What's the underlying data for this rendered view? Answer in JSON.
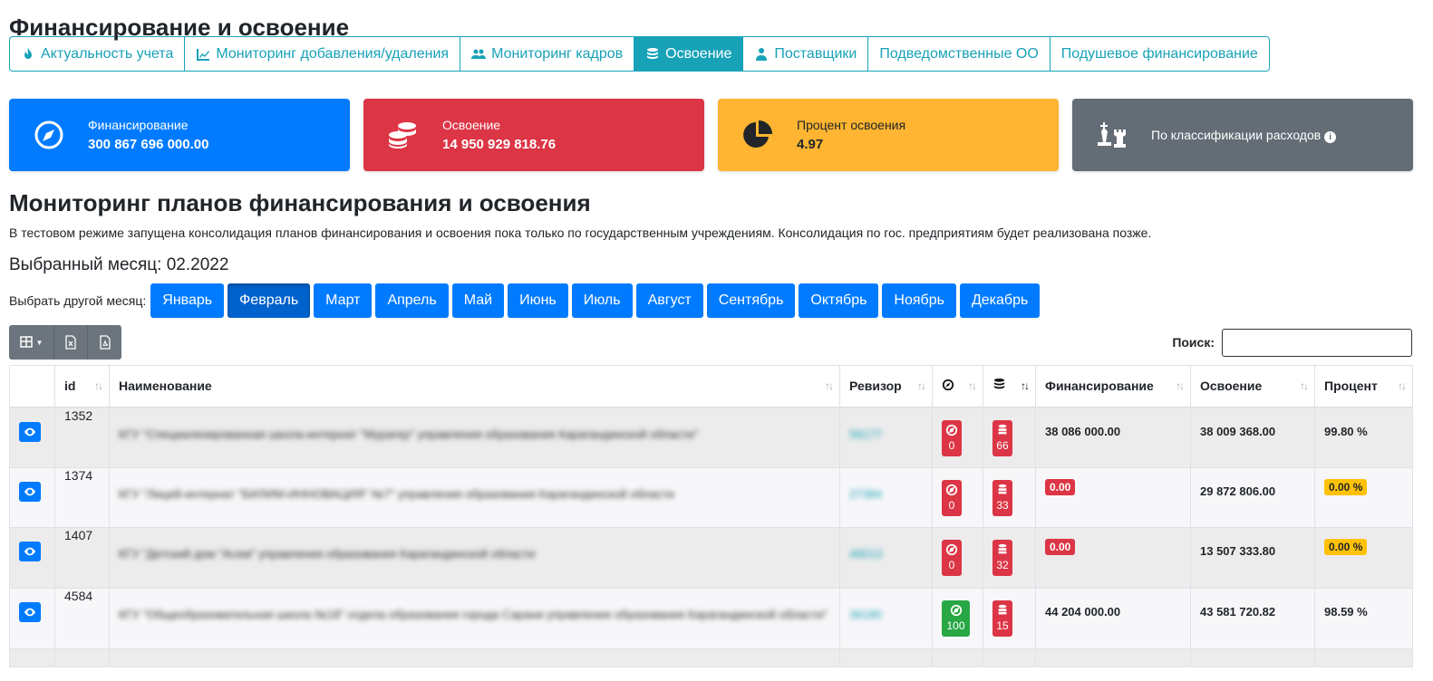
{
  "page_title": "Финансирование и освоение",
  "tabs": [
    {
      "label": "Актуальность учета",
      "icon": "fire-icon",
      "active": false
    },
    {
      "label": "Мониторинг добавления/удаления",
      "icon": "chart-line-icon",
      "active": false
    },
    {
      "label": "Мониторинг кадров",
      "icon": "users-icon",
      "active": false
    },
    {
      "label": "Освоение",
      "icon": "coins-icon",
      "active": true
    },
    {
      "label": "Поставщики",
      "icon": "user-tie-icon",
      "active": false
    },
    {
      "label": "Подведомственные ОО",
      "icon": "",
      "active": false
    },
    {
      "label": "Подушевое финансирование",
      "icon": "",
      "active": false
    }
  ],
  "cards": [
    {
      "title": "Финансирование",
      "value": "300 867 696 000.00",
      "icon": "compass-icon",
      "color": "#007bff"
    },
    {
      "title": "Освоение",
      "value": "14 950 929 818.76",
      "icon": "coins-icon",
      "color": "#dc3545"
    },
    {
      "title": "Процент освоения",
      "value": "4.97",
      "icon": "pie-chart-icon",
      "color": "#ffb531"
    },
    {
      "title": "По классификации расходов",
      "value": "",
      "icon": "chess-icon",
      "color": "#646d76"
    }
  ],
  "section_title": "Мониторинг планов финансирования и освоения",
  "note": "В тестовом режиме запущена консолидация планов финансирования и освоения пока только по государственным учреждениям. Консолидация по гос. предприятиям будет реализована позже.",
  "selected_month": "Выбранный месяц: 02.2022",
  "choose_month_label": "Выбрать другой месяц:",
  "months": [
    "Январь",
    "Февраль",
    "Март",
    "Апрель",
    "Май",
    "Июнь",
    "Июль",
    "Август",
    "Сентябрь",
    "Октябрь",
    "Ноябрь",
    "Декабрь"
  ],
  "active_month_index": 1,
  "search_label": "Поиск:",
  "search_value": "",
  "columns": [
    "",
    "id",
    "Наименование",
    "Ревизор",
    "",
    "",
    "Финансирование",
    "Освоение",
    "Процент"
  ],
  "rows": [
    {
      "id": "1352",
      "name": "КГУ \"Специализированная школа-интернат \"Мурагер\" управления образования Карагандинской области\"",
      "revisor": "58177",
      "compass_count": "0",
      "compass_color": "red",
      "coins_count": "66",
      "financing": "38 086 000.00",
      "financing_flag": false,
      "spent": "38 009 368.00",
      "percent": "99.80 %",
      "percent_flag": false
    },
    {
      "id": "1374",
      "name": "КГУ \"Лицей-интернат \"БИЛИМ-ИННОВАЦИЯ\" №7\" управления образования Карагандинской области",
      "revisor": "27384",
      "compass_count": "0",
      "compass_color": "red",
      "coins_count": "33",
      "financing": "0.00",
      "financing_flag": true,
      "spent": "29 872 806.00",
      "percent": "0.00 %",
      "percent_flag": true
    },
    {
      "id": "1407",
      "name": "КГУ \"Детский дом \"Асем\" управления образования Карагандинской области",
      "revisor": "48013",
      "compass_count": "0",
      "compass_color": "red",
      "coins_count": "32",
      "financing": "0.00",
      "financing_flag": true,
      "spent": "13 507 333.80",
      "percent": "0.00 %",
      "percent_flag": true
    },
    {
      "id": "4584",
      "name": "КГУ \"Общеобразовательная школа №18\" отдела образования города Сарани управления образования Карагандинской области\"",
      "revisor": "36180",
      "compass_count": "100",
      "compass_color": "green",
      "coins_count": "15",
      "financing": "44 204 000.00",
      "financing_flag": false,
      "spent": "43 581 720.82",
      "percent": "98.59 %",
      "percent_flag": false
    }
  ]
}
